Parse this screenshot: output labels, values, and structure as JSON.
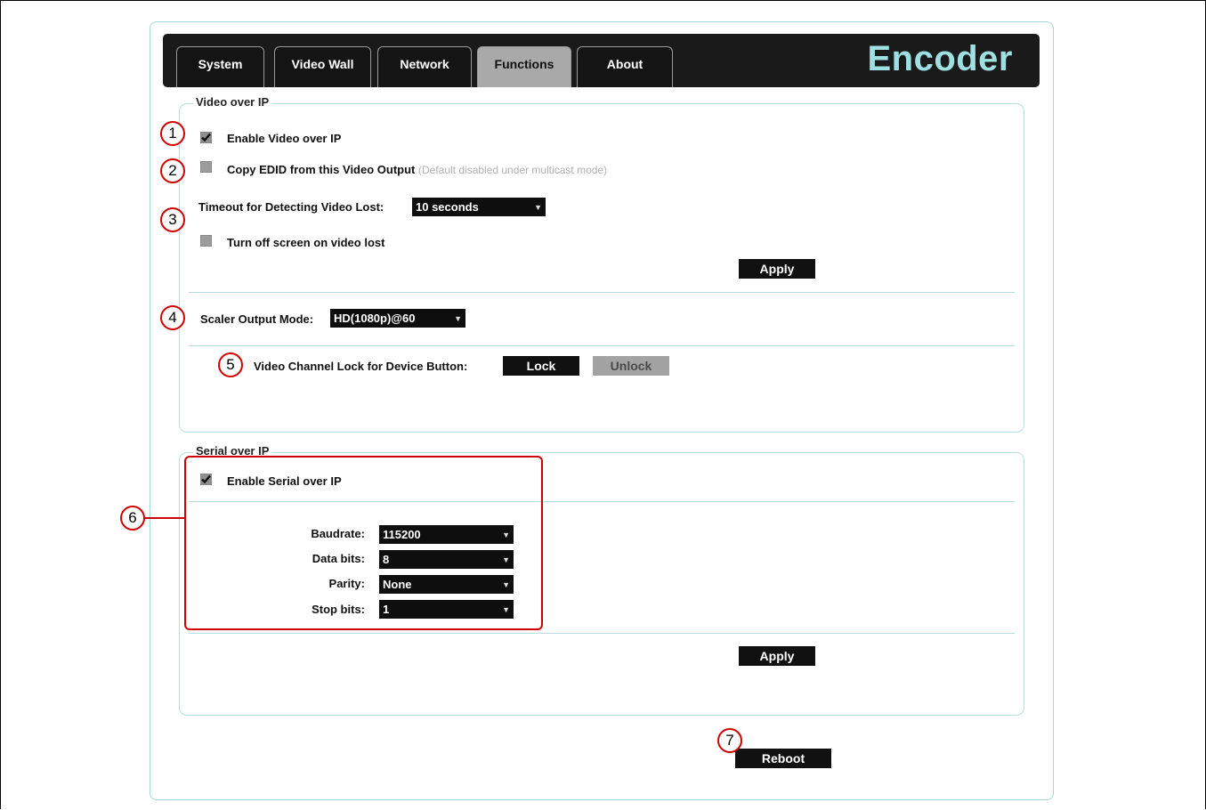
{
  "tabs": [
    {
      "label": "System"
    },
    {
      "label": "Video Wall"
    },
    {
      "label": "Network"
    },
    {
      "label": "Functions",
      "active": true
    },
    {
      "label": "About"
    }
  ],
  "brand": "Encoder",
  "video_over_ip": {
    "legend": "Video over IP",
    "enable_label": "Enable Video over IP",
    "enable_checked": true,
    "copy_edid_label": "Copy EDID from this Video Output",
    "copy_edid_hint": "(Default disabled under multicast mode)",
    "copy_edid_checked": false,
    "timeout_label": "Timeout for Detecting Video Lost:",
    "timeout_value": "10 seconds",
    "turn_off_label": "Turn off screen on video lost",
    "turn_off_checked": false,
    "apply_label": "Apply",
    "scaler_label": "Scaler Output Mode:",
    "scaler_value": "HD(1080p)@60",
    "lock_label": "Video Channel Lock for Device Button:",
    "lock_button": "Lock",
    "unlock_button": "Unlock"
  },
  "serial_over_ip": {
    "legend": "Serial over IP",
    "enable_label": "Enable Serial over IP",
    "enable_checked": true,
    "baudrate_label": "Baudrate:",
    "baudrate_value": "115200",
    "databits_label": "Data bits:",
    "databits_value": "8",
    "parity_label": "Parity:",
    "parity_value": "None",
    "stopbits_label": "Stop bits:",
    "stopbits_value": "1",
    "apply_label": "Apply"
  },
  "reboot_label": "Reboot",
  "callouts": [
    "1",
    "2",
    "3",
    "4",
    "5",
    "6",
    "7"
  ],
  "colors": {
    "tabbar_bg": "#1a1a1a",
    "active_tab_bg": "#a9a9a9",
    "brand_text": "#9edfe2",
    "panel_border": "#a8d6dd",
    "callout_red": "#d10000"
  }
}
